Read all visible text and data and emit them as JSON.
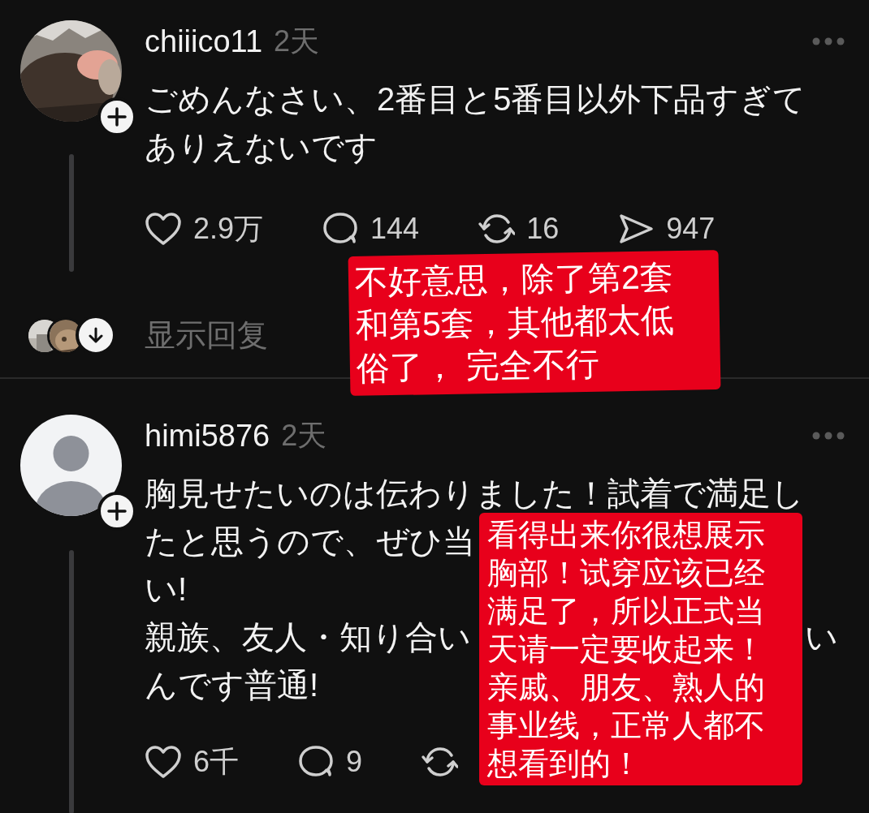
{
  "comments": [
    {
      "username": "chiiico11",
      "time": "2天",
      "lines": [
        {
          "text": "ごめんなさい、2番目と5番目以外下品すぎて"
        },
        {
          "text": "ありえないです"
        }
      ],
      "actions": [
        {
          "kind": "like",
          "count": "2.9万"
        },
        {
          "kind": "comment",
          "count": "144"
        },
        {
          "kind": "repost",
          "count": "16"
        },
        {
          "kind": "share",
          "count": "947"
        }
      ],
      "replies_label": "显示回复"
    },
    {
      "username": "himi5876",
      "time": "2天",
      "kind": "default",
      "lines": [
        {
          "text": "胸見せたいのは伝わりました！試着で満足し"
        },
        {
          "text": "たと思うので、ぜひ当"
        },
        {
          "text": "い!"
        },
        {
          "text": "親族、友人・知り合い",
          "end": "い"
        },
        {
          "text": "んです普通!"
        }
      ],
      "actions": [
        {
          "kind": "like",
          "count": "6千"
        },
        {
          "kind": "comment",
          "count": "9"
        },
        {
          "kind": "repost"
        }
      ]
    }
  ],
  "annotations": [
    {
      "lines": [
        "不好意思，除了第2套",
        "和第5套，其他都太低",
        "俗了， 完全不行"
      ]
    },
    {
      "lines": [
        "看得出来你很想展示",
        "胸部！试穿应该已经",
        "满足了，所以正式当",
        "天请一定要收起来！",
        "亲戚、朋友、熟人的",
        "事业线，正常人都不",
        "想看到的！"
      ]
    }
  ]
}
